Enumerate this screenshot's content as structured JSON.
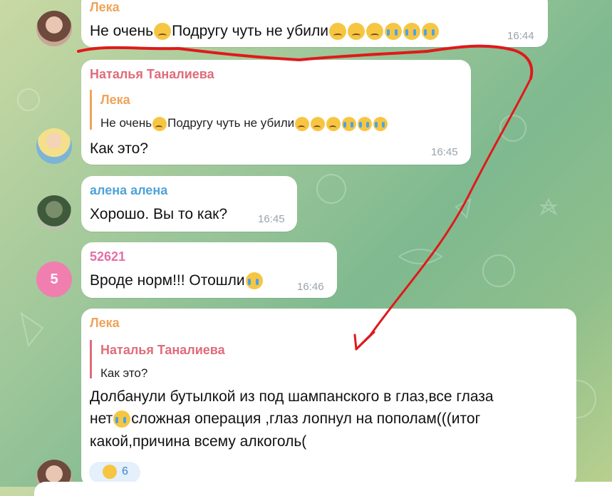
{
  "messages": [
    {
      "sender": "Лека",
      "text": "Не очень",
      "text_mid": "Подругу чуть не убили",
      "time": "16:44"
    },
    {
      "sender": "Наталья Таналиева",
      "quote_sender": "Лека",
      "quote_text": "Не очень",
      "quote_text_mid": "Подругу чуть не убили",
      "text": "Как это?",
      "time": "16:45"
    },
    {
      "sender": "алена алена",
      "text": "Хорошо. Вы то как?",
      "time": "16:45"
    },
    {
      "sender": "52621",
      "avatar_label": "5",
      "text": "Вроде норм!!! Отошли",
      "time": "16:46"
    },
    {
      "sender": "Лека",
      "quote_sender": "Наталья Таналиева",
      "quote_text": "Как это?",
      "text_lines": [
        "Долбанули бутылкой из под шампанского в глаз,все глаза",
        "нет",
        "сложная операция ,глаз лопнул на пополам(((итог",
        "какой,причина всему алкоголь("
      ]
    }
  ],
  "reaction": {
    "count": "6"
  },
  "colors": {
    "leka": "#f0a35a",
    "natalya": "#e06c7a",
    "alena": "#4fa3d8",
    "n52621": "#e36fa6",
    "annotation": "#e0191b"
  },
  "icons": [
    "sad-face-emoji",
    "unamused-face-emoji",
    "crying-face-emoji",
    "laughing-tears-emoji",
    "thumbs-up-emoji"
  ]
}
